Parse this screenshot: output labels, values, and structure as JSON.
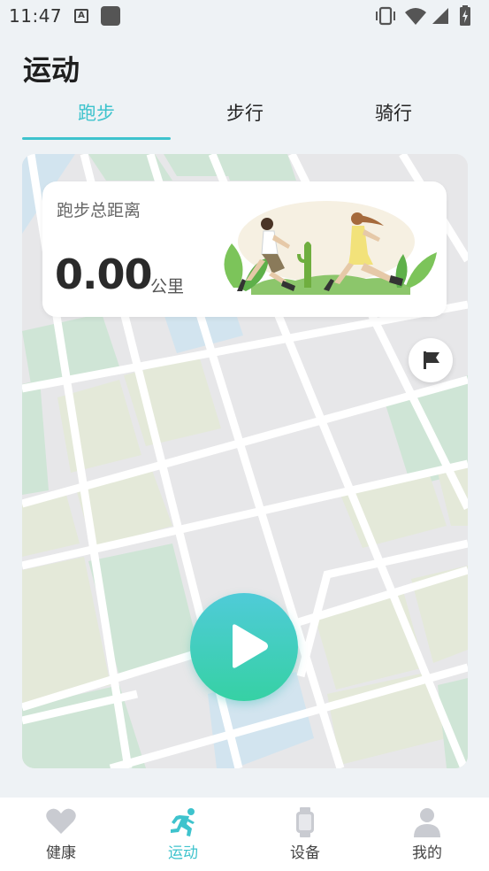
{
  "status_bar": {
    "time": "11:47",
    "notification_badge": "A"
  },
  "header": {
    "title": "运动"
  },
  "tabs": [
    {
      "label": "跑步",
      "active": true
    },
    {
      "label": "步行",
      "active": false
    },
    {
      "label": "骑行",
      "active": false
    }
  ],
  "stats": {
    "label": "跑步总距离",
    "value": "0.00",
    "unit": "公里"
  },
  "map": {
    "flag_icon": "flag-icon",
    "start_icon": "play-icon"
  },
  "bottom_nav": [
    {
      "label": "健康",
      "icon": "heart-icon",
      "active": false
    },
    {
      "label": "运动",
      "icon": "runner-icon",
      "active": true
    },
    {
      "label": "设备",
      "icon": "watch-icon",
      "active": false
    },
    {
      "label": "我的",
      "icon": "person-icon",
      "active": false
    }
  ],
  "colors": {
    "accent": "#3ec3cd",
    "start_gradient_top": "#4fcbd8",
    "start_gradient_bottom": "#36d1a4",
    "background": "#eef2f5"
  }
}
